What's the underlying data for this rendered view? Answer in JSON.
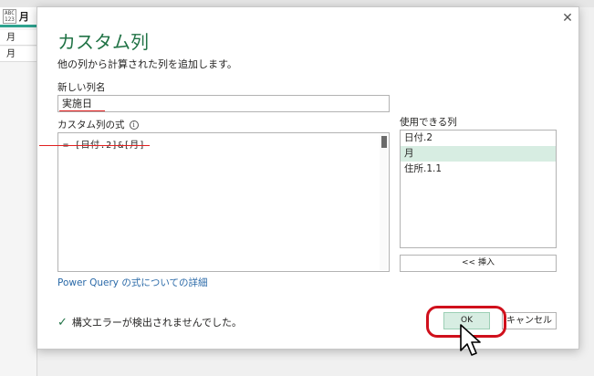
{
  "background": {
    "column_type_icon": "ABC\n123",
    "column_name": "月",
    "cells": [
      "月",
      "月"
    ]
  },
  "dialog": {
    "title": "カスタム列",
    "subtitle": "他の列から計算された列を追加します。",
    "new_column_name_label": "新しい列名",
    "new_column_name_value": "実施日",
    "formula_label": "カスタム列の式",
    "formula_value": "= [日付.2]&[月]",
    "available_columns_label": "使用できる列",
    "available_columns": [
      {
        "label": "日付.2",
        "selected": false
      },
      {
        "label": "月",
        "selected": true
      },
      {
        "label": "住所.1.1",
        "selected": false
      }
    ],
    "insert_button": "<< 挿入",
    "learn_more_link": "Power Query の式についての詳細",
    "status_message": "構文エラーが検出されませんでした。",
    "ok_button": "OK",
    "cancel_button": "キャンセル"
  },
  "colors": {
    "accent": "#217346",
    "selection": "#d7ede2",
    "annotation": "#d0101c",
    "link": "#2b6aa8"
  }
}
